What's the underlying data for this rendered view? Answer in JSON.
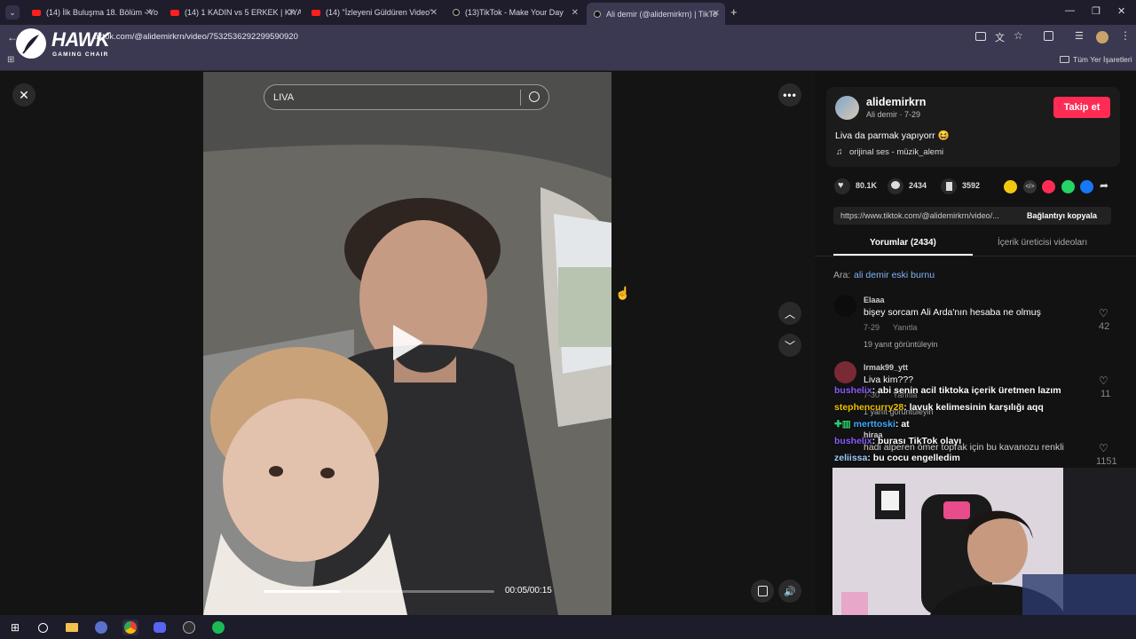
{
  "browser": {
    "tabs": [
      {
        "title": "(14) İlk Buluşma 18. Bölüm - Yo",
        "favicon": "youtube-icon"
      },
      {
        "title": "(14) 1 KADIN vs 5 ERKEK | KIYA",
        "favicon": "youtube-icon"
      },
      {
        "title": "(14) \"İzleyeni Güldüren Video\"",
        "favicon": "youtube-icon"
      },
      {
        "title": "(13)TikTok - Make Your Day",
        "favicon": "tiktok-icon"
      },
      {
        "title": "Ali demir (@alidemirkrn) | TikTo",
        "favicon": "tiktok-icon",
        "active": true
      }
    ],
    "url": "tiktok.com/@alidemirkrn/video/7532536292299590920",
    "bookmarks_label": "Tüm Yer İşaretleri"
  },
  "overlay_logo": {
    "brand": "HAWK",
    "sub": "GAMING CHAIR"
  },
  "video": {
    "search_value": "LIVA",
    "timecode": "00:05/00:15",
    "progress": 0.33
  },
  "author": {
    "username": "alidemirkrn",
    "display": "Ali demir · 7-29",
    "follow_label": "Takip et",
    "caption": "Liva da parmak yapıyorr 😆",
    "music": "orijinal ses - müzik_alemi"
  },
  "stats": {
    "likes": "80.1K",
    "comments": "2434",
    "saves": "3592"
  },
  "share": {
    "link": "https://www.tiktok.com/@alidemirkrn/video/...",
    "copy_label": "Bağlantıyı kopyala"
  },
  "tabs": {
    "comments": "Yorumlar (2434)",
    "creator_videos": "İçerik üreticisi videoları"
  },
  "search_suggest": {
    "prefix": "Ara:",
    "query": "ali demir eski burnu"
  },
  "comments": [
    {
      "user": "Elaaa",
      "text": "bişey sorcam Ali Arda'nın hesaba ne olmuş",
      "date": "7-29",
      "reply": "Yanıtla",
      "likes": "42",
      "view_replies": "19 yanıt görüntüleyin"
    },
    {
      "user": "Irmak99_ytt",
      "text": "Liva kim???",
      "date": "7-30",
      "reply": "Yanıtla",
      "likes": "11",
      "view_replies": "1 yanıt görüntüleyin"
    },
    {
      "user": "hiraa",
      "text": "hadi alperen ömer toprak için bu kavanozu renkli",
      "likes": "1151"
    }
  ],
  "stream_chat": [
    {
      "user": "bushelix",
      "msg": ": abi senin acil tiktoka içerik üretmen lazım"
    },
    {
      "user": "stephencurry28",
      "msg": ": lavuk kelimesinin karşılığı aqq"
    },
    {
      "user": "merttoski",
      "msg": ": at"
    },
    {
      "user": "bushelix",
      "msg": ": burası TikTok olayı"
    },
    {
      "user": "zeliissa",
      "msg": ": bu cocu engelledim"
    }
  ],
  "colors": {
    "accent": "#fe2c55",
    "chrome_bg": "#3b3951",
    "tab_bg": "#1f1d2b"
  }
}
